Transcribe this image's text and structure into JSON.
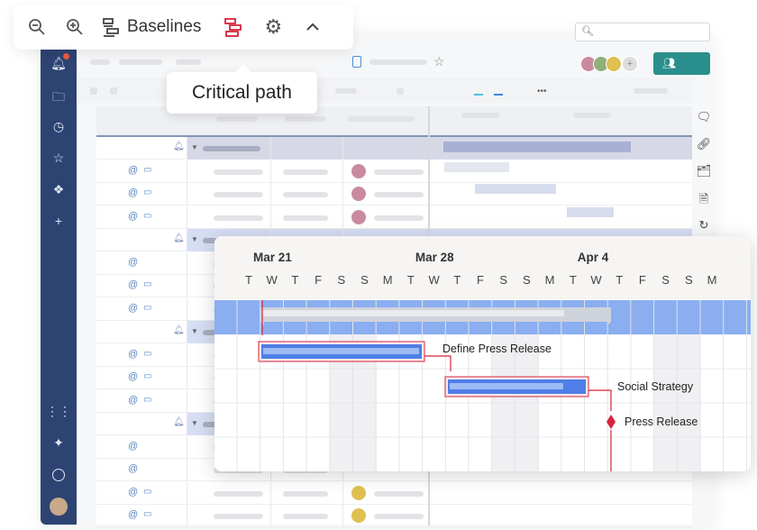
{
  "toolbar": {
    "zoom_out": "zoom-out-icon",
    "zoom_in": "zoom-in-icon",
    "baselines_label": "Baselines",
    "critical_path_icon_color": "#d6253a",
    "settings": "gear-icon",
    "collapse": "chevron-up-icon"
  },
  "tooltip": {
    "text": "Critical path"
  },
  "sidebar": {
    "notification_badge_color": "#e8553f",
    "items": [
      "bell-icon",
      "folder-icon",
      "clock-icon",
      "star-icon",
      "solutions-icon",
      "plus-icon"
    ],
    "bottom_items": [
      "apps-icon",
      "sparkle-icon",
      "help-icon",
      "avatar"
    ]
  },
  "header": {
    "share_icon": "people-icon"
  },
  "colors": {
    "sidebar": "#2d4372",
    "share": "#2a8f8d",
    "bar": "#4f7ee8",
    "band": "#8aaef0",
    "critical": "#d6253a"
  },
  "gantt": {
    "months": [
      {
        "label": "Mar 21",
        "day_index": 0
      },
      {
        "label": "Mar 28",
        "day_index": 7
      },
      {
        "label": "Apr 4",
        "day_index": 14
      }
    ],
    "days": [
      "T",
      "W",
      "T",
      "F",
      "S",
      "S",
      "M",
      "T",
      "W",
      "T",
      "F",
      "S",
      "S",
      "M",
      "T",
      "W",
      "T",
      "F",
      "S",
      "S",
      "M"
    ],
    "tasks": [
      {
        "label": "",
        "type": "summary"
      },
      {
        "label": "Define Press Release",
        "type": "task",
        "critical": true
      },
      {
        "label": "Social Strategy",
        "type": "task",
        "critical": true
      },
      {
        "label": "Press Release",
        "type": "milestone",
        "critical": true
      }
    ]
  }
}
